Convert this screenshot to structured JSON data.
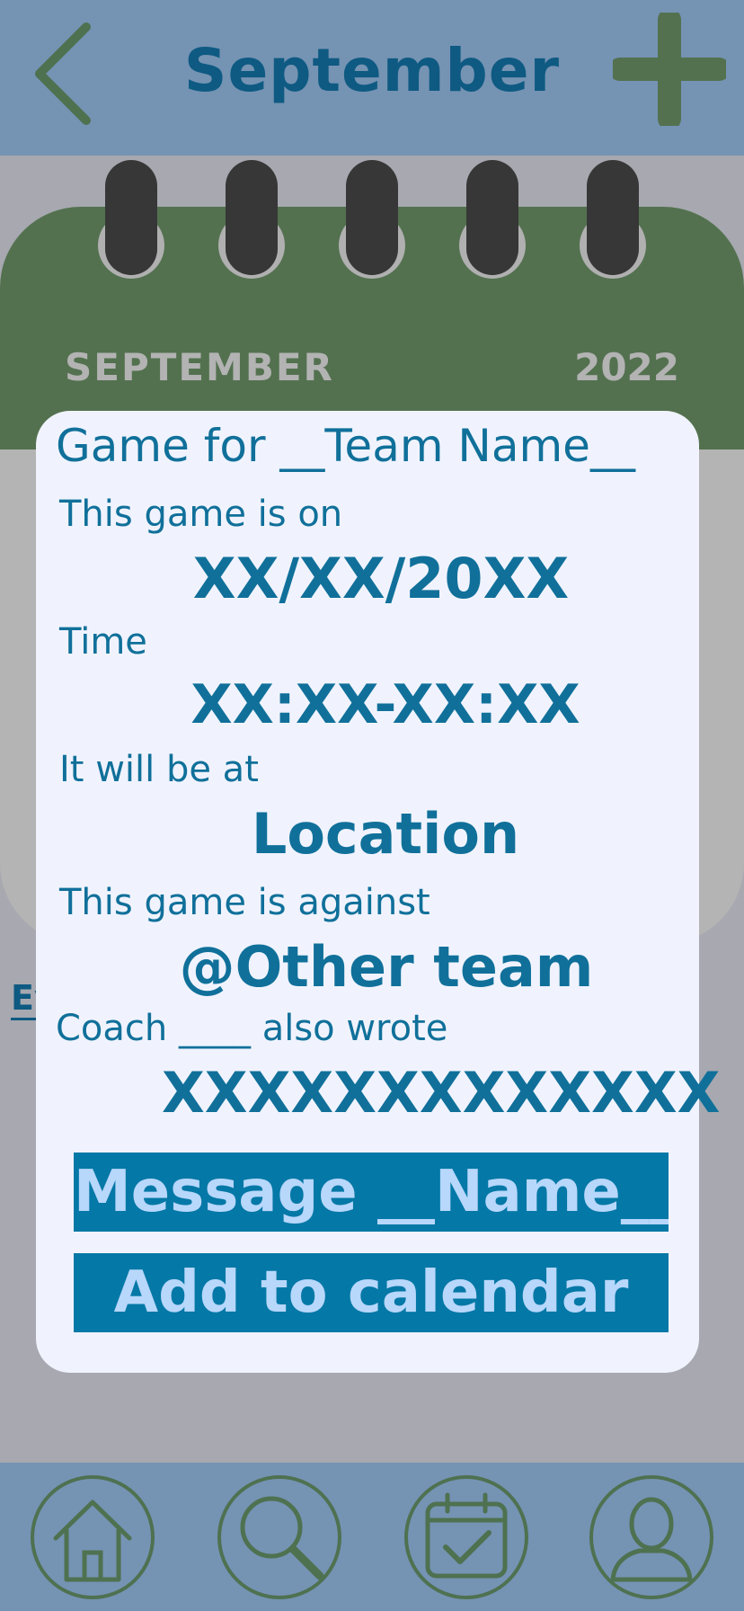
{
  "header": {
    "title": "September",
    "back_icon": "chevron-left-icon",
    "add_icon": "plus-icon"
  },
  "calendar": {
    "month": "SEPTEMBER",
    "year": "2022",
    "side_link": "Ev"
  },
  "modal": {
    "title": "Game for __Team Name__",
    "date_label": "This game is on",
    "date_value": "XX/XX/20XX",
    "time_label": "Time",
    "time_value": "XX:XX-XX:XX",
    "location_label": "It will be at",
    "location_value": "Location",
    "opponent_label": "This game is against",
    "opponent_value": "@Other team",
    "coach_label": "Coach ____ also wrote",
    "coach_value": "XXXXXXXXXXXXX",
    "message_button": "Message __Name__",
    "add_button": "Add to calendar"
  },
  "nav": {
    "items": [
      "home-icon",
      "search-icon",
      "calendar-check-icon",
      "profile-icon"
    ]
  },
  "colors": {
    "header_bg": "#7593b3",
    "title_blue": "#0e5a82",
    "accent_green": "#53714f",
    "button_bg": "#0478a6",
    "button_text": "#b7d7fb",
    "card_bg": "#f0f3fd"
  }
}
